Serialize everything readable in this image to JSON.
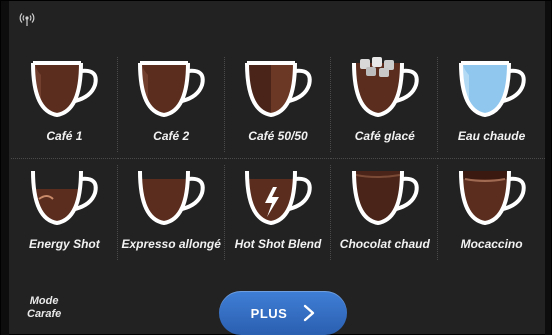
{
  "header": {
    "icon": "wireless-signal-icon"
  },
  "drinks": [
    {
      "label": "Café 1",
      "icon": "coffee-cup-icon"
    },
    {
      "label": "Café 2",
      "icon": "coffee-cup-icon"
    },
    {
      "label": "Café 50/50",
      "icon": "coffee-cup-icon"
    },
    {
      "label": "Café glacé",
      "icon": "iced-coffee-cup-icon"
    },
    {
      "label": "Eau chaude",
      "icon": "hot-water-cup-icon"
    },
    {
      "label": "Energy Shot",
      "icon": "energy-shot-cup-icon"
    },
    {
      "label": "Expresso allongé",
      "icon": "espresso-cup-icon"
    },
    {
      "label": "Hot Shot Blend",
      "icon": "hot-shot-cup-icon"
    },
    {
      "label": "Chocolat chaud",
      "icon": "hot-chocolate-cup-icon"
    },
    {
      "label": "Mocaccino",
      "icon": "mocaccino-cup-icon"
    }
  ],
  "footer": {
    "mode_line1": "Mode",
    "mode_line2": "Carafe",
    "plus_label": "PLUS",
    "plus_icon": "chevron-right-icon"
  },
  "colors": {
    "background": "#222222",
    "coffee": "#5a2d1e",
    "water": "#8fc7ef",
    "button": "#3a74c9"
  }
}
